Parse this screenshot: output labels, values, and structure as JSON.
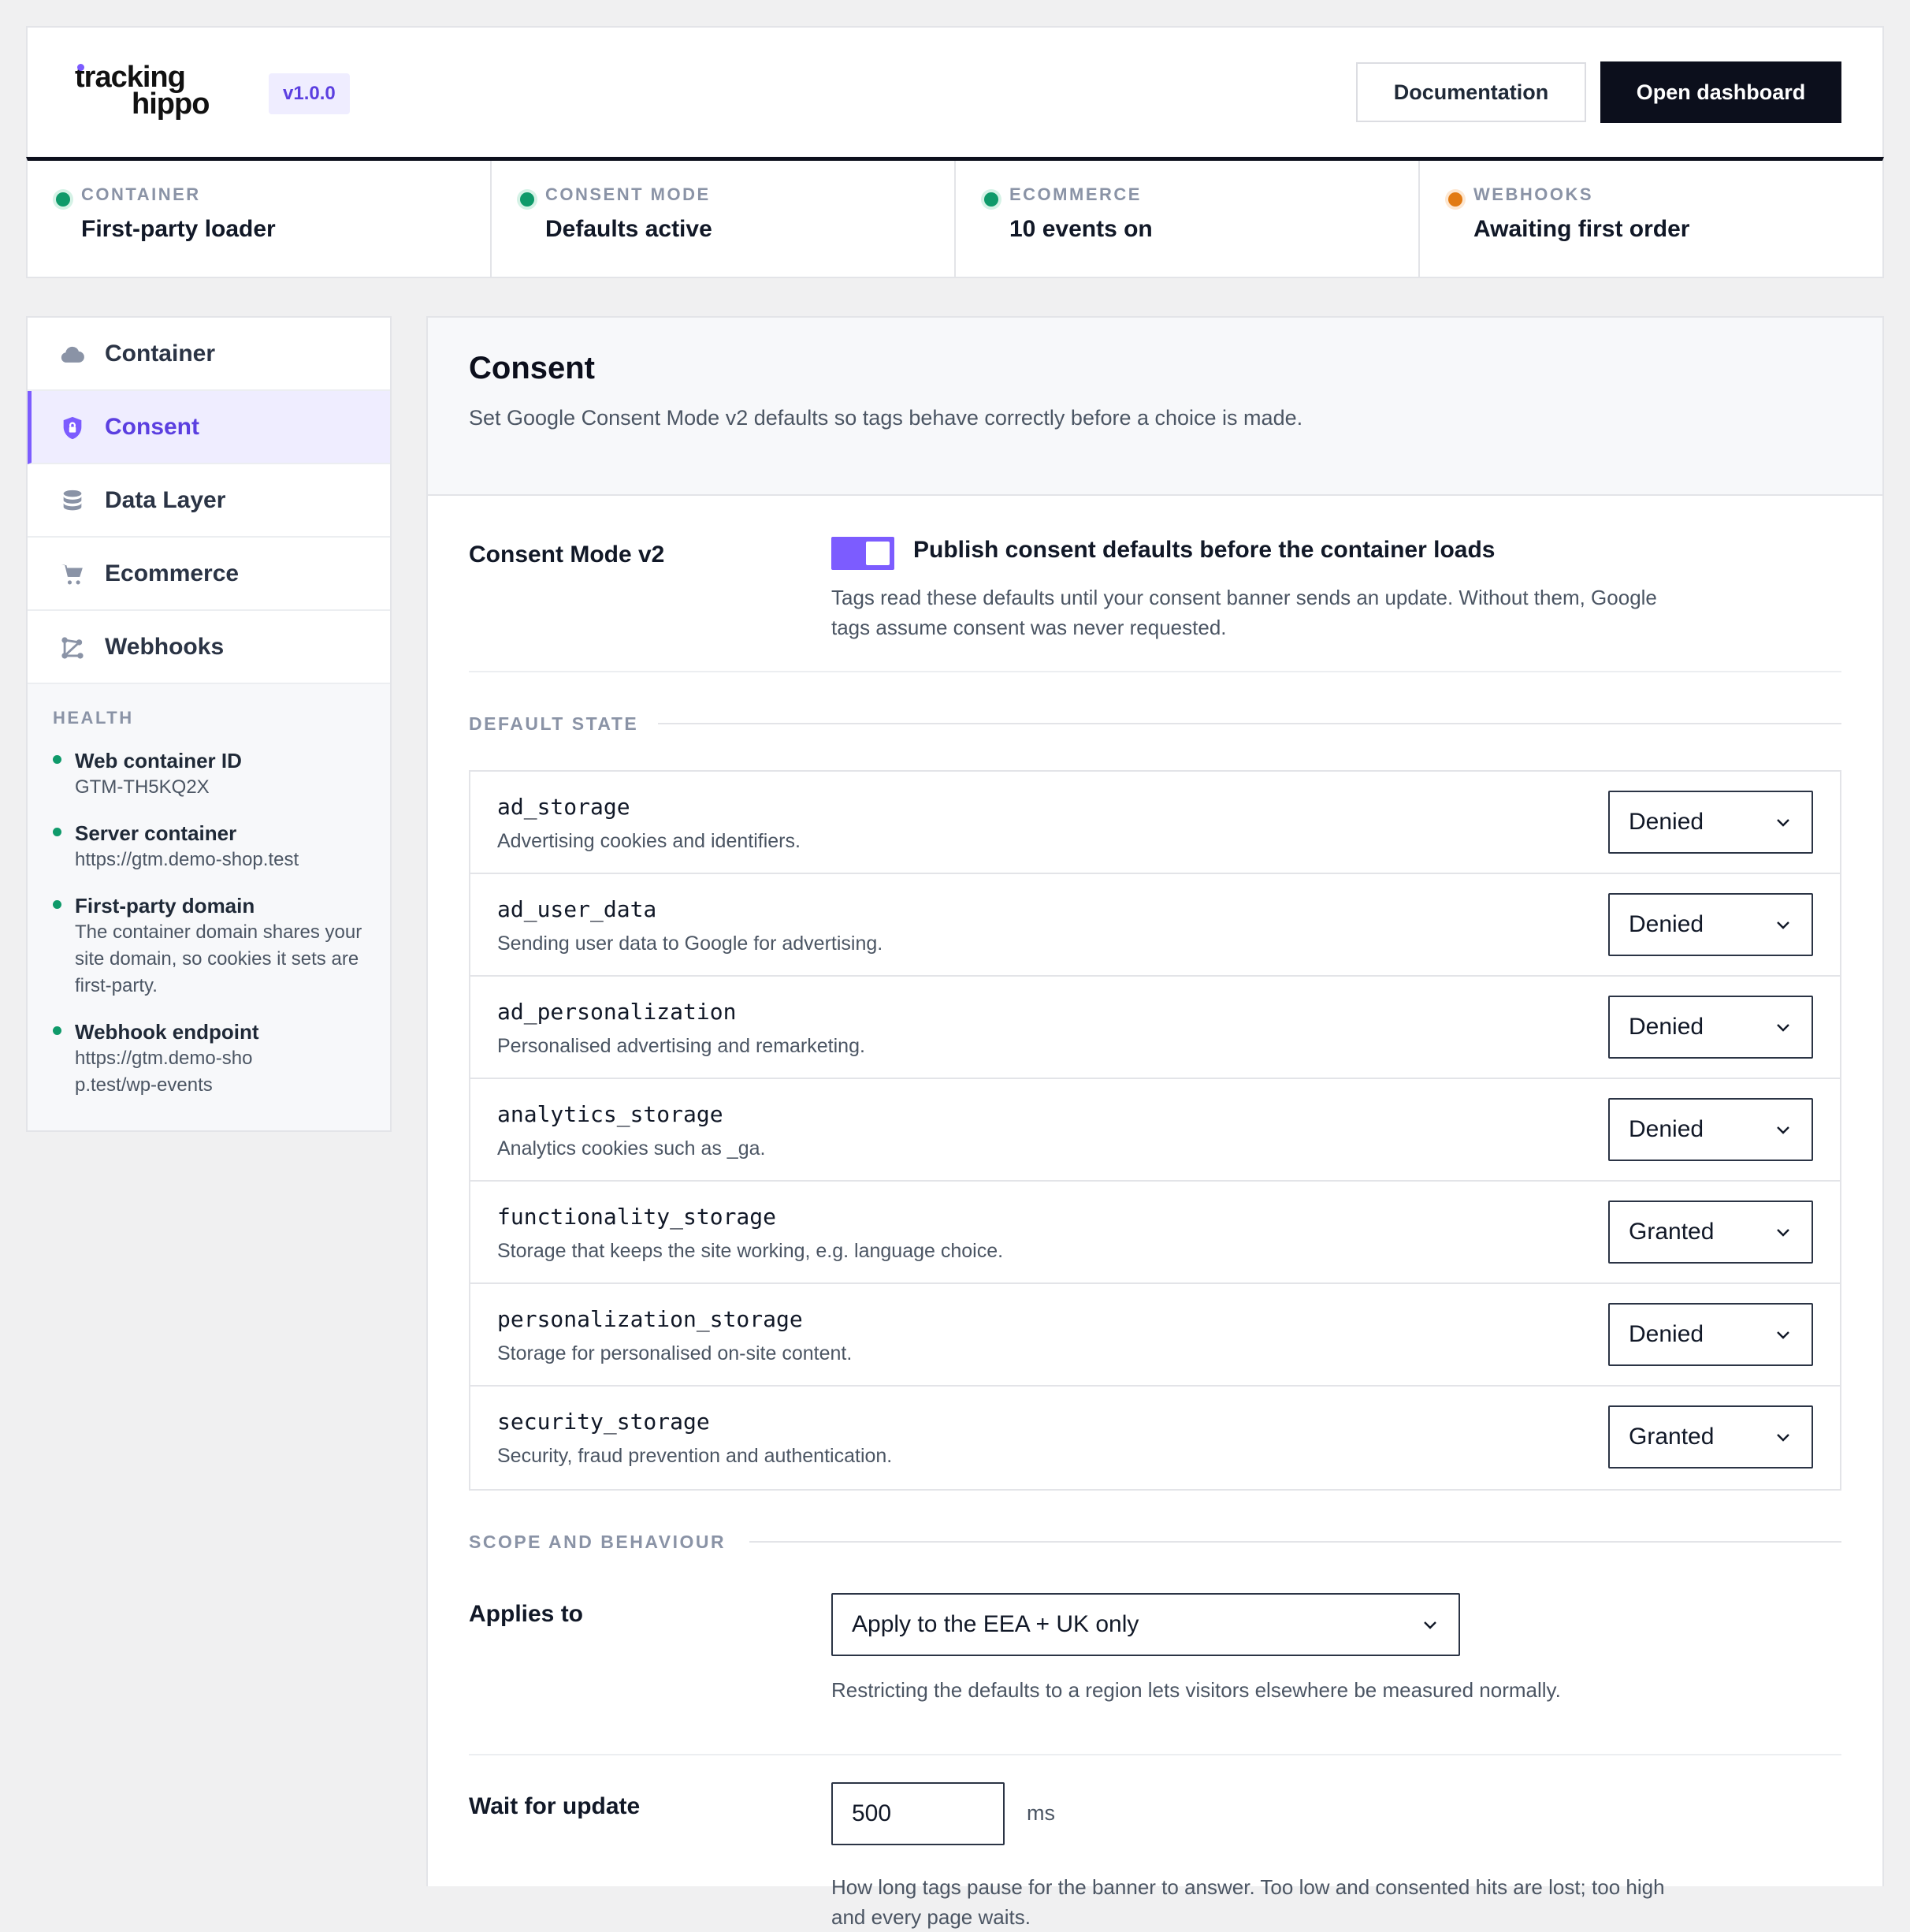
{
  "header": {
    "logo_line1": "tracking",
    "logo_line2": "hippo",
    "version": "v1.0.0",
    "documentation_label": "Documentation",
    "open_dashboard_label": "Open dashboard"
  },
  "status": [
    {
      "label": "CONTAINER",
      "value": "First-party loader",
      "state": "ok"
    },
    {
      "label": "CONSENT MODE",
      "value": "Defaults active",
      "state": "ok"
    },
    {
      "label": "ECOMMERCE",
      "value": "10 events on",
      "state": "ok"
    },
    {
      "label": "WEBHOOKS",
      "value": "Awaiting first order",
      "state": "warn"
    }
  ],
  "sidebar": {
    "items": [
      {
        "label": "Container",
        "icon": "cloud-icon"
      },
      {
        "label": "Consent",
        "icon": "shield-lock-icon",
        "active": true
      },
      {
        "label": "Data Layer",
        "icon": "database-icon"
      },
      {
        "label": "Ecommerce",
        "icon": "cart-icon"
      },
      {
        "label": "Webhooks",
        "icon": "webhook-icon"
      }
    ],
    "health_title": "HEALTH",
    "health": [
      {
        "name": "Web container ID",
        "value": "GTM-TH5KQ2X"
      },
      {
        "name": "Server container",
        "value": "https://gtm.demo-shop.test"
      },
      {
        "name": "First-party domain",
        "value": "The container domain shares your site domain, so cookies it sets are first-party."
      },
      {
        "name": "Webhook endpoint",
        "value": "https://gtm.demo-shop.test/wp-events"
      }
    ]
  },
  "main": {
    "title": "Consent",
    "description": "Set Google Consent Mode v2 defaults so tags behave correctly before a choice is made.",
    "consent_mode": {
      "label": "Consent Mode v2",
      "toggle_on": true,
      "toggle_title": "Publish consent defaults before the container loads",
      "help": "Tags read these defaults until your consent banner sends an update. Without them, Google tags assume consent was never requested."
    },
    "default_state_title": "DEFAULT STATE",
    "consent_types": [
      {
        "key": "ad_storage",
        "desc": "Advertising cookies and identifiers.",
        "value": "Denied"
      },
      {
        "key": "ad_user_data",
        "desc": "Sending user data to Google for advertising.",
        "value": "Denied"
      },
      {
        "key": "ad_personalization",
        "desc": "Personalised advertising and remarketing.",
        "value": "Denied"
      },
      {
        "key": "analytics_storage",
        "desc": "Analytics cookies such as _ga.",
        "value": "Denied"
      },
      {
        "key": "functionality_storage",
        "desc": "Storage that keeps the site working, e.g. language choice.",
        "value": "Granted"
      },
      {
        "key": "personalization_storage",
        "desc": "Storage for personalised on-site content.",
        "value": "Denied"
      },
      {
        "key": "security_storage",
        "desc": "Security, fraud prevention and authentication.",
        "value": "Granted"
      }
    ],
    "scope_title": "SCOPE AND BEHAVIOUR",
    "applies_to": {
      "label": "Applies to",
      "value": "Apply to the EEA + UK only",
      "help": "Restricting the defaults to a region lets visitors elsewhere be measured normally."
    },
    "wait_for_update": {
      "label": "Wait for update",
      "value": "500",
      "unit": "ms",
      "help": "How long tags pause for the banner to answer. Too low and consented hits are lost; too high and every page waits."
    }
  }
}
